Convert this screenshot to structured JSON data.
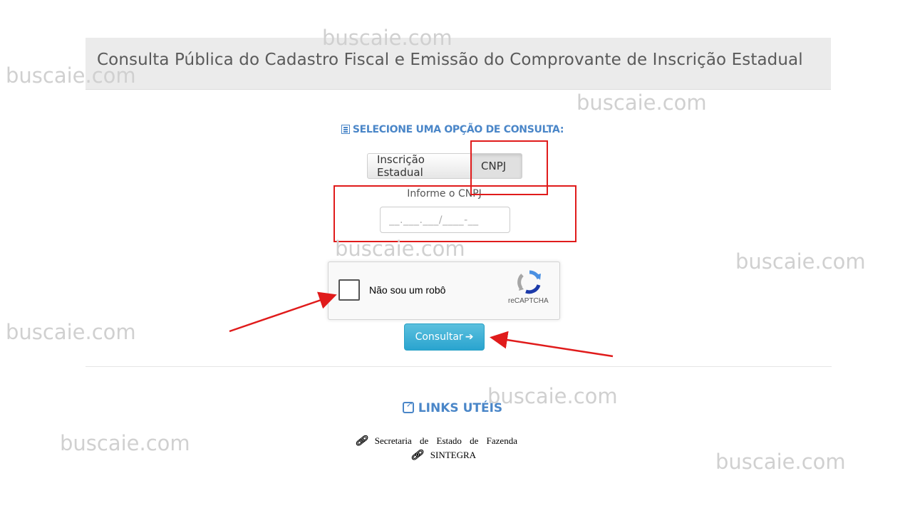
{
  "header": {
    "title": "Consulta Pública do Cadastro Fiscal e Emissão do Comprovante de Inscrição Estadual"
  },
  "consulta": {
    "section_title": "SELECIONE UMA OPÇÃO DE CONSULTA:",
    "options": [
      "Inscrição Estadual",
      "CNPJ"
    ],
    "selected_option": "CNPJ",
    "cnpj_label": "Informe o CNPJ",
    "cnpj_placeholder": "__.___.___/____-__"
  },
  "recaptcha": {
    "label": "Não sou um robô",
    "brand": "reCAPTCHA"
  },
  "submit": {
    "label": "Consultar"
  },
  "links": {
    "title": "LINKS UTÉIS",
    "items": [
      "Secretaria de Estado de Fazenda",
      "SINTEGRA"
    ]
  },
  "watermark_text": "buscaie.com",
  "colors": {
    "accent": "#4a86c8",
    "button": "#31b0d5",
    "annotation": "#e01b1b"
  }
}
